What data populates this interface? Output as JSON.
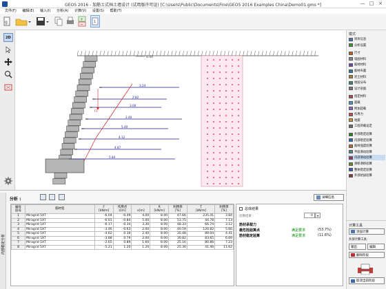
{
  "titlebar": {
    "title": "GEOS 2016 - 加筋土式挡土墙设计 (试用版许可证) [C:\\Users\\Public\\Documents\\Fine\\GEOS 2016 Examples China\\Demo01.gms *]",
    "min": "—",
    "max": "□",
    "close": "×"
  },
  "menu": [
    "文件(F)",
    "编辑(E)",
    "输入(I)",
    "分析(A)",
    "计算(V)",
    "设置(S)",
    "帮助(T)"
  ],
  "toolbar": {
    "mode_2d": "2D"
  },
  "canvas": {
    "dim_label": "0.40",
    "rib_labels": [
      "3.24",
      "2.82",
      "3.00",
      "2.40",
      "5.40",
      "4.12",
      "4.87",
      "5.84"
    ],
    "force_label": "F1",
    "surface_teeth": 64
  },
  "rightpanel": {
    "header": "模式",
    "items": [
      "项目信息",
      "分析设置",
      "尺寸",
      "墙面材料",
      "筋材材料",
      "筋材布置",
      "岩土材料",
      "地层分布",
      "设计剖面",
      "指定材料",
      "超载",
      "附加超载",
      "作用力",
      "地震",
      "工程荷载设定",
      "外部稳定验算",
      "内部稳定验算",
      "筋材强度验算",
      "平面滑动验算",
      "内部滑动验算",
      "滑移滑移验算",
      "整体稳定验算",
      "外部抗拔验算"
    ],
    "selected_index": 19
  },
  "bottom": {
    "label": "分析 :",
    "detail_button": "详细信息",
    "vertical_label": "内部稳定分析",
    "columns": [
      "编号\n层号",
      "筋材名",
      "F\n[kN/m]",
      "作用点\nz[m]",
      "\nx[m]",
      "R\n[kN/m]",
      "利用率\n[%]",
      "T\n[kN/m]",
      "利用率\n[%]"
    ],
    "rows": [
      [
        "1",
        "Miragrid 5XT",
        "-6.04",
        "-0.49",
        "4.00",
        "8.00",
        "47.66",
        "235.41",
        "3.84"
      ],
      [
        "2",
        "Miragrid 5XT",
        "-6.01",
        "-0.84",
        "5.00",
        "8.00",
        "53.75",
        "44.78",
        "7.13"
      ],
      [
        "3",
        "Miragrid 5XT",
        "-6.17",
        "-0.34",
        "3.30",
        "8.00",
        "48.33",
        "66.74",
        "3.12"
      ],
      [
        "4",
        "Miragrid 5XT",
        "-3.46",
        "-0.63",
        "2.00",
        "8.00",
        "40.59",
        "120.82",
        "5.66"
      ],
      [
        "5",
        "Miragrid 5XT",
        "-4.62",
        "0.39",
        "2.40",
        "8.00",
        "35.48",
        "89.04",
        "4.41"
      ],
      [
        "6",
        "Miragrid 5XT",
        "-3.88",
        "0.79",
        "2.00",
        "8.00",
        "30.82",
        "83.65",
        "6.69"
      ],
      [
        "7",
        "Miragrid 5XT",
        "-2.65",
        "0.89",
        "1.60",
        "8.00",
        "25.16",
        "80.86",
        "7.23"
      ],
      [
        "8",
        "Miragrid 5XT",
        "-5.21",
        "1.20",
        "1.20",
        "8.00",
        "25.30",
        "41.46",
        "11.62"
      ]
    ],
    "results": {
      "checkbox_label": "总体结果",
      "field_label": "验算结果 :",
      "field_value": "0",
      "title": "筋材承载力",
      "line1_label": "最危险验算点",
      "line1_status": "满足要求",
      "line1_pct": "(53.7%)",
      "line2_label": "筋材稳定验算",
      "line2_status": "满足要求",
      "line2_pct": "(11.6%)"
    }
  },
  "rbottom": {
    "header": "计算工具",
    "item1": "添加计算",
    "item2": "外部计算工具:",
    "item3": "输出",
    "item4": "编辑",
    "item5": "删除阶段",
    "btn_bottom": "取消当前阶段"
  },
  "colors": {
    "wall": "#b5b5b5",
    "soil_fill": "#fde9ef",
    "soil_dot": "#e0143c",
    "rib": "#1a1a8c",
    "slip": "#d42020"
  }
}
